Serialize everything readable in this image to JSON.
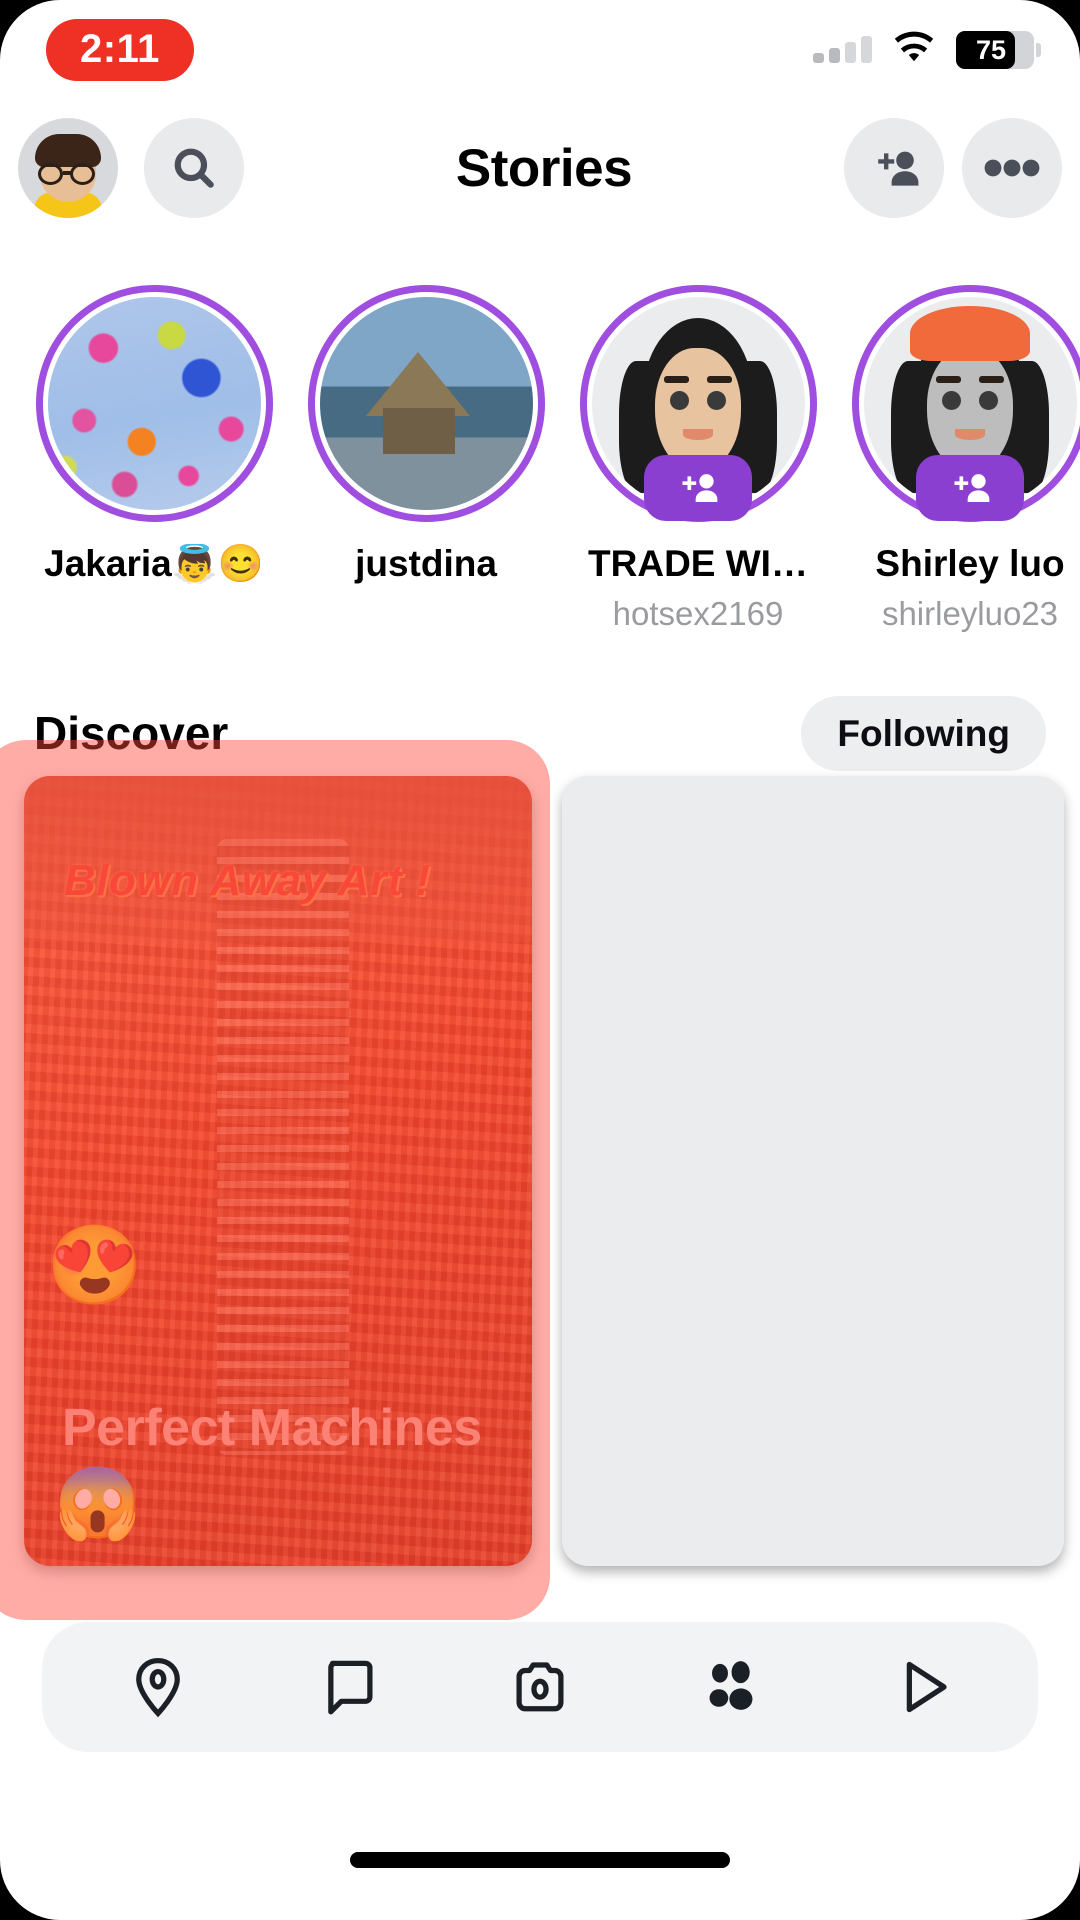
{
  "status_bar": {
    "time": "2:11",
    "time_pill_color": "#EE3124",
    "battery_percent": "75",
    "battery_level": 75,
    "wifi_icon": "wifi-icon",
    "cellular_icon": "cellular-bars-icon",
    "cellular_bars_on": 2
  },
  "header": {
    "title": "Stories",
    "profile_icon": "bitmoji-avatar",
    "search_icon": "search-icon",
    "add_friend_icon": "add-friend-icon",
    "more_icon": "more-options-icon"
  },
  "stories": [
    {
      "name": "Jakaria👼😊",
      "username": "",
      "thumb": "flowers-photo",
      "ring_color": "#9F4EE0",
      "has_add_badge": false
    },
    {
      "name": "justdina",
      "username": "",
      "thumb": "building-photo",
      "ring_color": "#9F4EE0",
      "has_add_badge": false
    },
    {
      "name": "TRADE WI…",
      "username": "hotsex2169",
      "thumb": "bitmoji-woman-dark-hair",
      "ring_color": "#9F4EE0",
      "has_add_badge": true,
      "badge_icon": "add-friend-icon"
    },
    {
      "name": "Shirley luo",
      "username": "shirleyluo23",
      "thumb": "bitmoji-woman-orange-hat",
      "ring_color": "#9F4EE0",
      "has_add_badge": true,
      "badge_icon": "add-friend-icon"
    }
  ],
  "discover": {
    "section_title": "Discover",
    "following_label": "Following"
  },
  "cards": [
    {
      "overlay_title": "Blown Away Art !",
      "title": "Perfect Machines",
      "top_emoji": "😍",
      "bottom_emoji": "😱",
      "thumb": "orange-corn-machine-photo",
      "highlighted": true,
      "highlight_color": "#FF463C"
    },
    {
      "overlay_title": "",
      "title": "",
      "top_emoji": "",
      "bottom_emoji": "",
      "thumb": "loading-placeholder",
      "highlighted": false
    }
  ],
  "bottom_nav": [
    {
      "label": "Map",
      "icon": "map-pin-icon",
      "active": false
    },
    {
      "label": "Chat",
      "icon": "chat-bubble-icon",
      "active": false
    },
    {
      "label": "Camera",
      "icon": "camera-icon",
      "active": false
    },
    {
      "label": "Stories",
      "icon": "friends-icon",
      "active": true
    },
    {
      "label": "Spotlight",
      "icon": "play-triangle-icon",
      "active": false
    }
  ]
}
